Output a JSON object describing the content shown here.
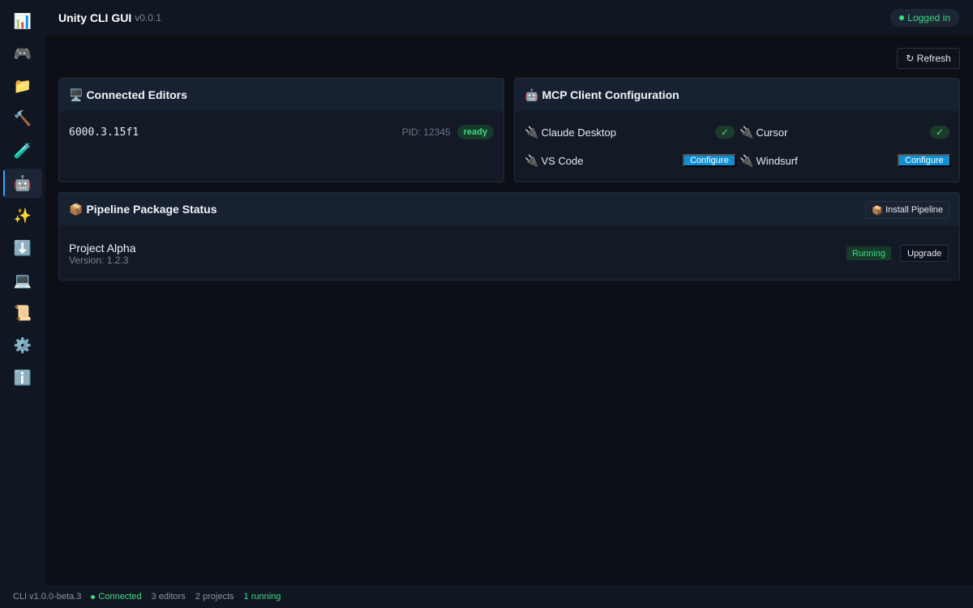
{
  "app": {
    "title": "Unity CLI GUI",
    "version": "v0.0.1",
    "login_status": "Logged in"
  },
  "sidebar": {
    "items": [
      {
        "icon": "dashboard-icon",
        "glyph": "📊"
      },
      {
        "icon": "gamepad-icon",
        "glyph": "🎮"
      },
      {
        "icon": "folder-icon",
        "glyph": "📁"
      },
      {
        "icon": "hammer-icon",
        "glyph": "🔨"
      },
      {
        "icon": "test-tube-icon",
        "glyph": "🧪"
      },
      {
        "icon": "robot-icon",
        "glyph": "🤖",
        "active": true
      },
      {
        "icon": "sparkles-icon",
        "glyph": "✨"
      },
      {
        "icon": "download-icon",
        "glyph": "⬇️"
      },
      {
        "icon": "laptop-icon",
        "glyph": "💻"
      },
      {
        "icon": "scroll-icon",
        "glyph": "📜"
      },
      {
        "icon": "gear-icon",
        "glyph": "⚙️"
      },
      {
        "icon": "info-icon",
        "glyph": "ℹ️"
      }
    ]
  },
  "toolbar": {
    "refresh_label": "↻ Refresh"
  },
  "connected_editors": {
    "emoji": "🖥️",
    "title": "Connected Editors",
    "editors": [
      {
        "version": "6000.3.15f1",
        "pid": "PID: 12345",
        "status": "ready"
      }
    ]
  },
  "mcp_config": {
    "emoji": "🤖",
    "title": "MCP Client Configuration",
    "plug_glyph": "🔌",
    "clients": [
      {
        "name": "Claude Desktop",
        "state": "configured",
        "indicator": "✓"
      },
      {
        "name": "Cursor",
        "state": "configured",
        "indicator": "✓"
      },
      {
        "name": "VS Code",
        "state": "unconfigured",
        "action": "Configure"
      },
      {
        "name": "Windsurf",
        "state": "unconfigured",
        "action": "Configure"
      }
    ]
  },
  "pipeline": {
    "emoji": "📦",
    "title": "Pipeline Package Status",
    "install_label": "Install Pipeline",
    "install_emoji": "📦",
    "project": {
      "name": "Project Alpha",
      "version": "Version: 1.2.3",
      "status": "Running",
      "action": "Upgrade"
    }
  },
  "statusbar": {
    "cli_version": "CLI v1.0.0-beta.3",
    "connection": "Connected",
    "editors": "3 editors",
    "projects": "2 projects",
    "running": "1 running"
  },
  "colors": {
    "accent_green": "#3ddc84",
    "configure_blue": "#0e8fd6",
    "active_indicator": "#3ba0ff"
  }
}
